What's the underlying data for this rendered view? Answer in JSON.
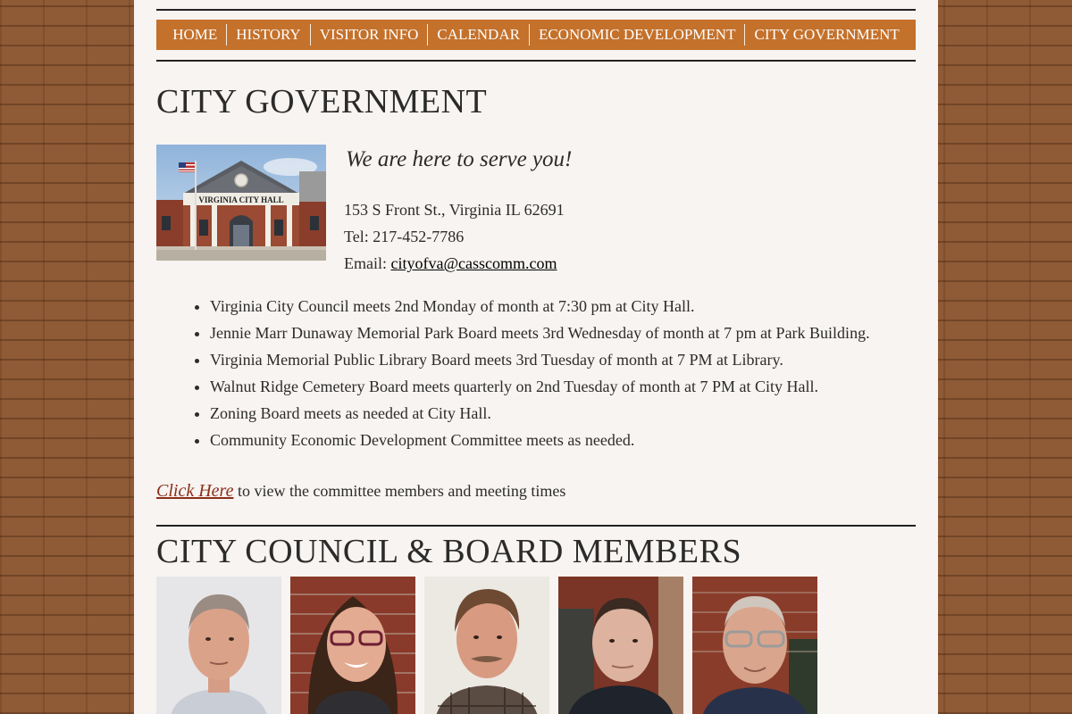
{
  "nav": {
    "items": [
      "HOME",
      "HISTORY",
      "VISITOR INFO",
      "CALENDAR",
      "ECONOMIC DEVELOPMENT",
      "CITY GOVERNMENT"
    ]
  },
  "page": {
    "title": "CITY GOVERNMENT",
    "tagline": "We are here to serve you!",
    "address": "153 S Front St., Virginia IL 62691",
    "tel": "Tel: 217-452-7786",
    "email_label": "Email: ",
    "email": "cityofva@casscomm.com",
    "image_sign_text": "VIRGINIA CITY HALL"
  },
  "meetings": [
    "Virginia City Council meets 2nd Monday of month at 7:30 pm at City Hall.",
    "Jennie Marr Dunaway Memorial Park Board meets 3rd Wednesday of month at 7 pm at Park Building.",
    "Virginia Memorial Public Library Board meets 3rd Tuesday of month at 7 PM at Library.",
    "Walnut Ridge Cemetery Board meets quarterly on 2nd Tuesday of month at 7 PM at City Hall.",
    "Zoning Board meets as needed at City Hall.",
    "Community Economic Development Committee meets as needed."
  ],
  "click": {
    "link": "Click Here",
    "text": " to view the committee members and meeting times"
  },
  "members_title": "CITY COUNCIL & BOARD MEMBERS",
  "colors": {
    "nav": "#c4712b",
    "page_bg": "#f8f4f1",
    "body_bg": "#8f5a36",
    "link": "#8b2e1b"
  }
}
